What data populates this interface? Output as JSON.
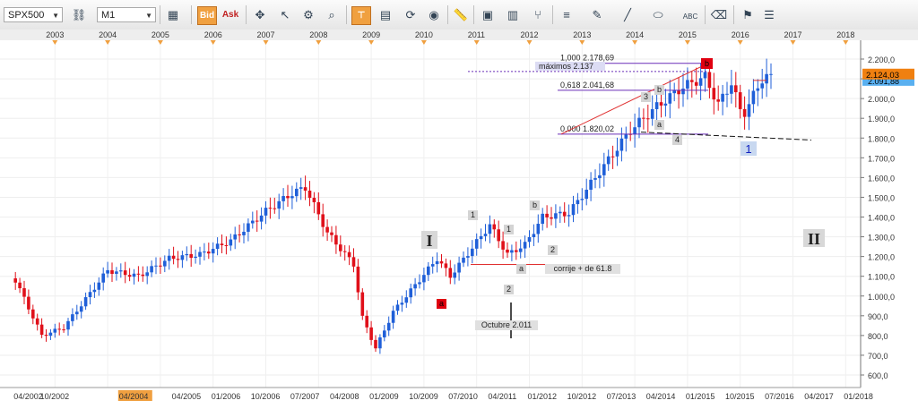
{
  "toolbar": {
    "symbol": "SPX500",
    "timeframe": "M1",
    "bid_label": "Bid",
    "ask_label": "Ask",
    "icons": [
      "link-icon",
      "palette-icon",
      "chart-type-icon",
      "crosshair-icon",
      "cursor-icon",
      "zoom-icon",
      "trendline-tool-icon",
      "note-icon",
      "refresh-icon",
      "globe-icon",
      "ruler-icon",
      "picture-icon",
      "indicator-icon",
      "fork-icon",
      "lines-icon",
      "pencil-icon",
      "line-icon",
      "arrow-icon",
      "ellipse-icon",
      "text-icon",
      "eraser-icon",
      "basket-icon",
      "menu-icon"
    ],
    "colors": {
      "accent": "#f0a040"
    }
  },
  "chart_data": {
    "type": "candlestick",
    "symbol": "SPX500",
    "timeframe": "monthly",
    "year_labels": [
      "2003",
      "2004",
      "2005",
      "2006",
      "2007",
      "2008",
      "2009",
      "2010",
      "2011",
      "2012",
      "2013",
      "2014",
      "2015",
      "2016",
      "2017",
      "2018"
    ],
    "x_tick_labels": [
      "04/2002",
      "10/2002",
      "04/2004",
      "04/2005",
      "01/2006",
      "10/2006",
      "07/2007",
      "04/2008",
      "01/2009",
      "10/2009",
      "07/2010",
      "04/2011",
      "01/2012",
      "10/2012",
      "07/2013",
      "04/2014",
      "01/2015",
      "10/2015",
      "07/2016",
      "04/2017",
      "01/2018"
    ],
    "highlighted_x_label": "04/2004",
    "y_ticks": [
      "2.200,0",
      "2.100,0",
      "2.000,0",
      "1.900,0",
      "1.800,0",
      "1.700,0",
      "1.600,0",
      "1.500,0",
      "1.400,0",
      "1.300,0",
      "1.200,0",
      "1.100,0",
      "1.000,0",
      "900,0",
      "800,0",
      "700,0",
      "600,0"
    ],
    "ylim": [
      560,
      2250
    ],
    "current_price": "2.124,03",
    "secondary_price": "2.091,88",
    "colors": {
      "up": "#1f5fd8",
      "down": "#e0101a",
      "fib": "#6a2fb8",
      "trend": "#e03030",
      "support": "#111111"
    },
    "anchors": [
      {
        "date": "2002-04",
        "close": 1080
      },
      {
        "date": "2002-10",
        "close": 800
      },
      {
        "date": "2003-03",
        "close": 840
      },
      {
        "date": "2004-01",
        "close": 1130
      },
      {
        "date": "2004-08",
        "close": 1100
      },
      {
        "date": "2005-03",
        "close": 1190
      },
      {
        "date": "2005-10",
        "close": 1210
      },
      {
        "date": "2006-05",
        "close": 1280
      },
      {
        "date": "2007-01",
        "close": 1430
      },
      {
        "date": "2007-07",
        "close": 1520
      },
      {
        "date": "2007-10",
        "close": 1550
      },
      {
        "date": "2008-03",
        "close": 1320
      },
      {
        "date": "2008-09",
        "close": 1160
      },
      {
        "date": "2008-11",
        "close": 890
      },
      {
        "date": "2009-02",
        "close": 735
      },
      {
        "date": "2009-06",
        "close": 920
      },
      {
        "date": "2010-04",
        "close": 1190
      },
      {
        "date": "2010-07",
        "close": 1100
      },
      {
        "date": "2011-04",
        "close": 1360
      },
      {
        "date": "2011-08",
        "close": 1210
      },
      {
        "date": "2011-12",
        "close": 1260
      },
      {
        "date": "2012-04",
        "close": 1400
      },
      {
        "date": "2012-10",
        "close": 1420
      },
      {
        "date": "2013-05",
        "close": 1630
      },
      {
        "date": "2013-12",
        "close": 1840
      },
      {
        "date": "2014-06",
        "close": 1960
      },
      {
        "date": "2014-12",
        "close": 2060
      },
      {
        "date": "2015-05",
        "close": 2110
      },
      {
        "date": "2015-08",
        "close": 1970
      },
      {
        "date": "2015-11",
        "close": 2080
      },
      {
        "date": "2016-01",
        "close": 1940
      },
      {
        "date": "2016-02",
        "close": 1930
      },
      {
        "date": "2016-06",
        "close": 2100
      },
      {
        "date": "2016-08",
        "close": 2124
      }
    ],
    "fib_levels": [
      {
        "label": "1,000 2.178,69",
        "value": 2178.69
      },
      {
        "label": "0,618 2.041,68",
        "value": 2041.68
      },
      {
        "label": "0,000 1.820,02",
        "value": 1820.02
      }
    ],
    "max_line": {
      "label": "máximos 2.137",
      "value": 2137
    },
    "annotations": [
      {
        "text": "I",
        "kind": "roman"
      },
      {
        "text": "II",
        "kind": "roman"
      },
      {
        "text": "corrije + de 61.8",
        "kind": "note"
      },
      {
        "text": "Octubre 2.011",
        "kind": "note"
      },
      {
        "text": "1",
        "kind": "wave-blue"
      },
      {
        "text": "a",
        "kind": "wave-red"
      },
      {
        "text": "b",
        "kind": "wave-red"
      },
      {
        "text": "1",
        "kind": "wave"
      },
      {
        "text": "2",
        "kind": "wave"
      },
      {
        "text": "a",
        "kind": "wave"
      },
      {
        "text": "b",
        "kind": "wave"
      },
      {
        "text": "1",
        "kind": "wave"
      },
      {
        "text": "2",
        "kind": "wave"
      },
      {
        "text": "3",
        "kind": "wave"
      },
      {
        "text": "a",
        "kind": "wave"
      },
      {
        "text": "b",
        "kind": "wave"
      },
      {
        "text": "4",
        "kind": "wave"
      }
    ]
  }
}
